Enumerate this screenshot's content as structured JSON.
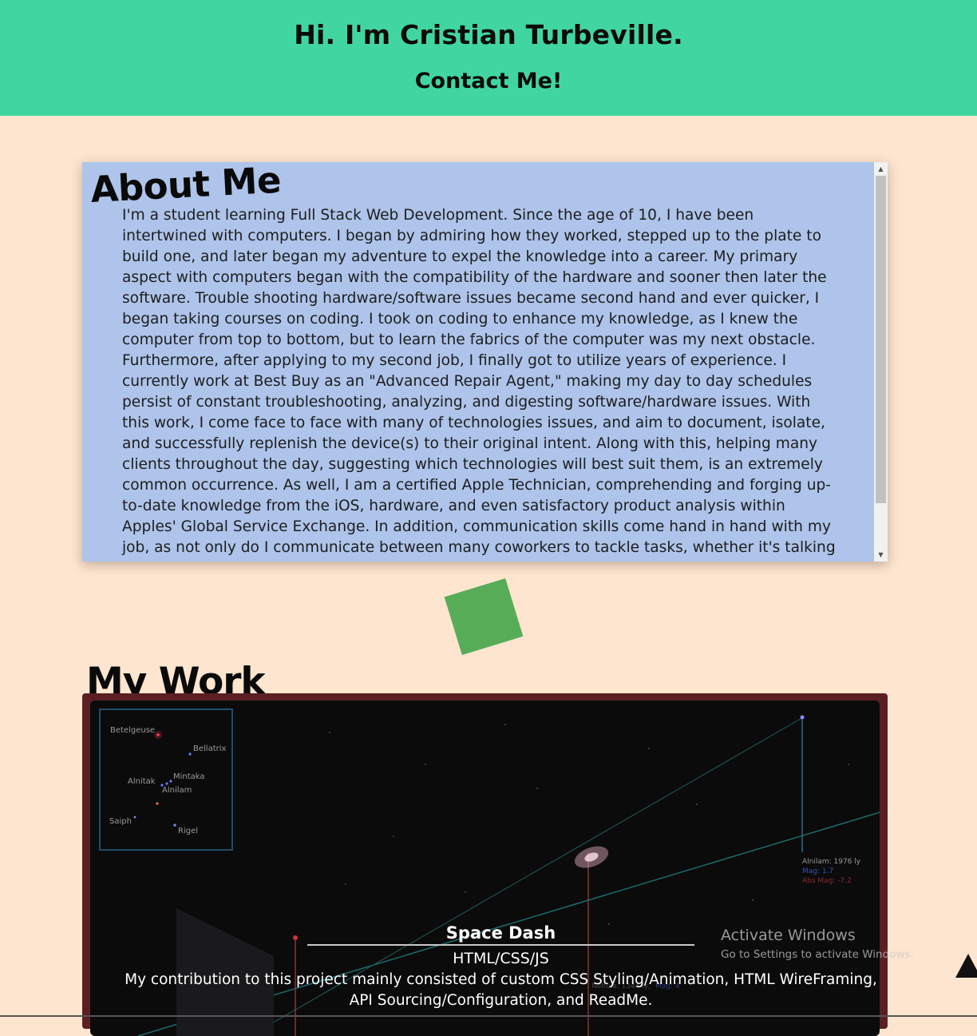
{
  "header": {
    "title": "Hi. I'm Cristian Turbeville.",
    "contact_label": "Contact Me!",
    "background": "#41d6a0"
  },
  "about": {
    "heading": "About Me",
    "text": "I'm a student learning Full Stack Web Development. Since the age of 10, I have been intertwined with computers. I began by admiring how they worked, stepped up to the plate to build one, and later began my adventure to expel the knowledge into a career. My primary aspect with computers began with the compatibility of the hardware and sooner then later the software. Trouble shooting hardware/software issues became second hand and ever quicker, I began taking courses on coding. I took on coding to enhance my knowledge, as I knew the computer from top to bottom, but to learn the fabrics of the computer was my next obstacle. Furthermore, after applying to my second job, I finally got to utilize years of experience. I currently work at Best Buy as an \"Advanced Repair Agent,\" making my day to day schedules persist of constant troubleshooting, analyzing, and digesting software/hardware issues. With this work, I come face to face with many of technologies issues, and aim to document, isolate, and successfully replenish the device(s) to their original intent. Along with this, helping many clients throughout the day, suggesting which technologies will best suit them, is an extremely common occurrence. As well, I am a certified Apple Technician, comprehending and forging up-to-date knowledge from the iOS, hardware, and even satisfactory product analysis within Apples' Global Service Exchange. In addition, communication skills come hand in hand with my job, as not only do I communicate between many coworkers to tackle tasks, whether it's talking over the phone or in person with a client, I strive to fully understand, comprehend, and conglomerate the issue",
    "background": "#aec4ea"
  },
  "work": {
    "heading": "My Work",
    "project": {
      "title": "Space Dash",
      "tech": "HTML/CSS/JS",
      "description": "My contribution to this project mainly consisted of custom CSS Styling/Animation, HTML WireFraming, API Sourcing/Configuration, and ReadMe."
    },
    "screenshot_labels": {
      "betelgeuse": "Betelgeuse",
      "bellatrix": "Bellatrix",
      "alnitak": "Alnitak",
      "mintaka": "Mintaka",
      "alnilam": "Alnilam",
      "saiph": "Saiph",
      "rigel": "Rigel",
      "alnilam_distance": "Alnilam: 1976 ly",
      "mag": "Mag: 1.7",
      "abs_mag": "Abs Mag: -7.2",
      "nebula": "Nebula: 1344 ly,",
      "nebula_mag": "Mag: 4"
    }
  },
  "watermark": {
    "title": "Activate Windows",
    "subtitle": "Go to Settings to activate Windows."
  },
  "icons": {
    "back_to_top": "triangle-up-icon",
    "scroll_up": "chevron-up-icon",
    "scroll_down": "chevron-down-icon"
  }
}
